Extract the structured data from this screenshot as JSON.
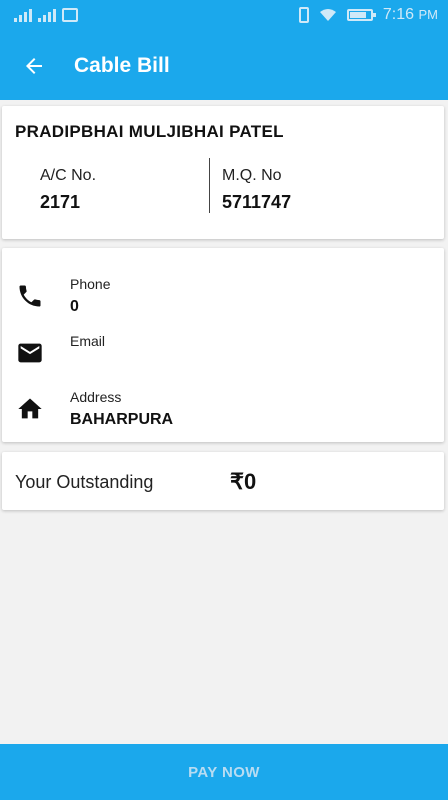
{
  "status_bar": {
    "time": "7:16",
    "ampm": "PM",
    "icons": [
      "signal-icon",
      "image-icon",
      "vibrate-icon",
      "wifi-icon",
      "battery-icon"
    ],
    "battery_level": 0.8
  },
  "app_bar": {
    "title": "Cable Bill",
    "back_icon": "arrow-back-icon"
  },
  "customer": {
    "name": "PRADIPBHAI MULJIBHAI PATEL",
    "ac_label": "A/C No.",
    "ac_value": "2171",
    "mq_label": "M.Q. No",
    "mq_value": "5711747"
  },
  "contact": {
    "phone_label": "Phone",
    "phone_value": "0",
    "email_label": "Email",
    "email_value": "",
    "address_label": "Address",
    "address_value": "BAHARPURA"
  },
  "outstanding": {
    "label": "Your Outstanding",
    "value": "₹0"
  },
  "pay_button": {
    "label": "PAY NOW"
  },
  "colors": {
    "primary": "#1ba8ec",
    "pay_text": "#b8dcf2"
  }
}
